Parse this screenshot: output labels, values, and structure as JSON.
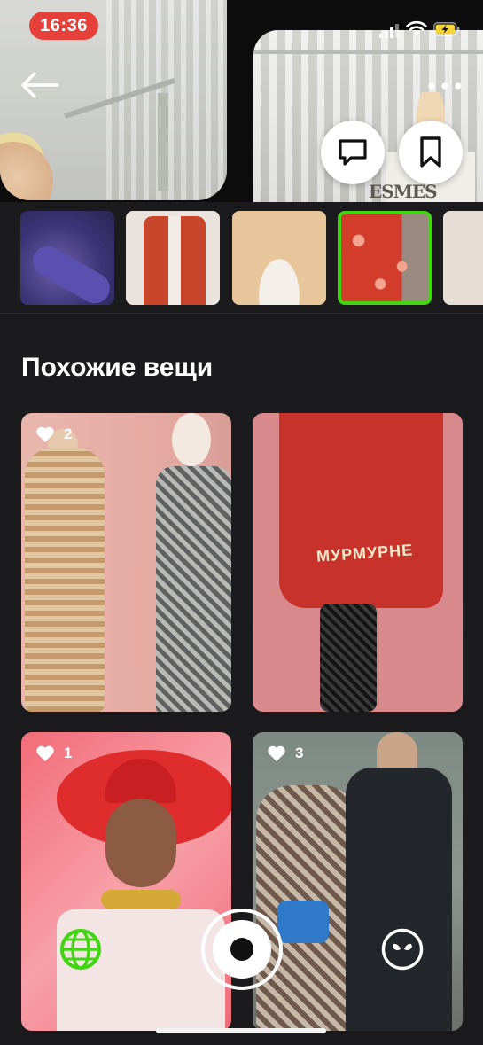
{
  "status_bar": {
    "time": "16:36",
    "time_pill_color": "#e5403a",
    "icons": [
      "signal-icon",
      "wifi-icon",
      "battery-charging-icon"
    ]
  },
  "header": {
    "icons": {
      "back": "arrow-left-icon",
      "more": "more-dots-icon",
      "comment": "comment-icon",
      "bookmark": "bookmark-icon"
    }
  },
  "thumbnails": {
    "count": 5,
    "selected_index": 3,
    "selected_border_color": "#43d414"
  },
  "similar": {
    "title": "Похожие вещи",
    "cards": [
      {
        "likes": "2"
      },
      {
        "text_on_item": "МУРМУРНЕ"
      },
      {
        "likes": "1"
      },
      {
        "likes": "3"
      }
    ]
  },
  "bottom_bar": {
    "icons": {
      "left": "globe-icon",
      "center": "capture-icon",
      "right": "alien-icon"
    },
    "globe_color": "#43d414"
  }
}
